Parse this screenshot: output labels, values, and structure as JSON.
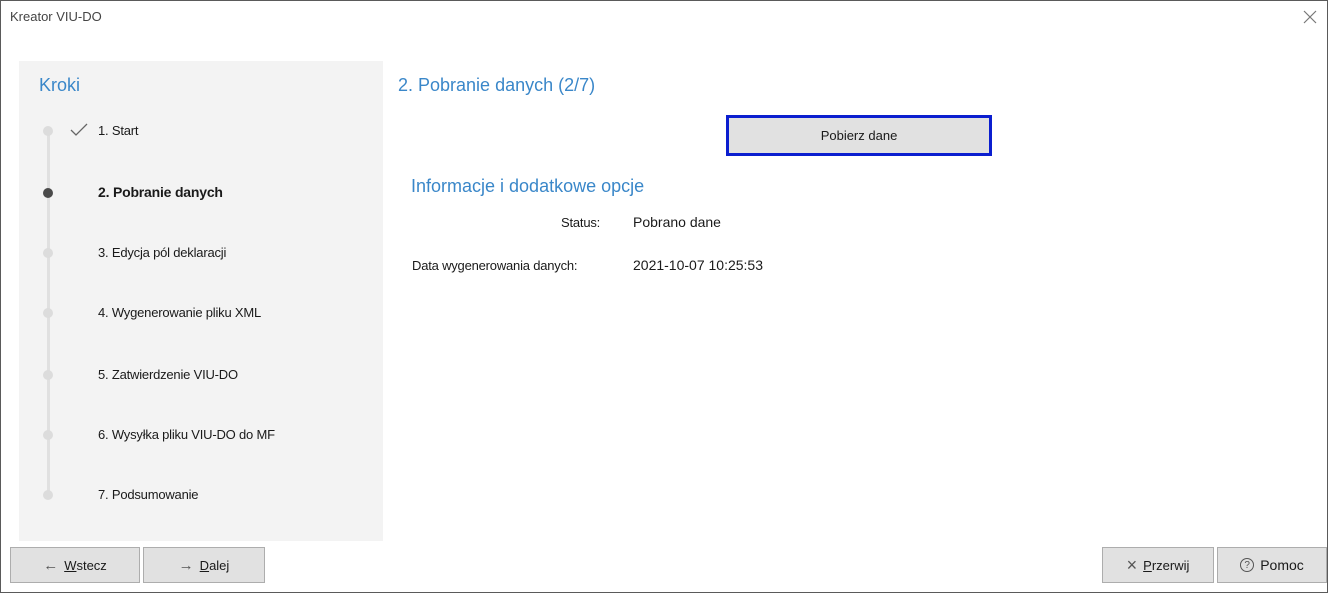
{
  "window": {
    "title": "Kreator VIU-DO",
    "close_icon": "close-icon"
  },
  "sidebar": {
    "title": "Kroki",
    "steps": [
      {
        "label": "1. Start",
        "state": "done"
      },
      {
        "label": "2. Pobranie danych",
        "state": "active"
      },
      {
        "label": "3. Edycja pól deklaracji",
        "state": "pending"
      },
      {
        "label": "4. Wygenerowanie pliku XML",
        "state": "pending"
      },
      {
        "label": "5. Zatwierdzenie VIU-DO",
        "state": "pending"
      },
      {
        "label": "6. Wysyłka pliku VIU-DO do MF",
        "state": "pending"
      },
      {
        "label": "7. Podsumowanie",
        "state": "pending"
      }
    ]
  },
  "main": {
    "title": "2. Pobranie danych (2/7)",
    "fetch_button": "Pobierz dane",
    "section_title": "Informacje i dodatkowe opcje",
    "status_label": "Status:",
    "status_value": "Pobrano dane",
    "date_label": "Data wygenerowania danych:",
    "date_value": "2021-10-07 10:25:53"
  },
  "footer": {
    "back": {
      "arrow": "←",
      "mnemonic": "W",
      "rest": "stecz"
    },
    "next": {
      "arrow": "→",
      "mnemonic": "D",
      "rest": "alej"
    },
    "abort": {
      "icon": "×",
      "mnemonic": "P",
      "rest": "rzerwij"
    },
    "help": {
      "icon": "?",
      "label": "Pomoc"
    }
  },
  "colors": {
    "accent": "#3a87c9",
    "focus_border": "#0b1ecf",
    "sidebar_bg": "#f3f3f3",
    "button_bg": "#e1e1e1"
  }
}
